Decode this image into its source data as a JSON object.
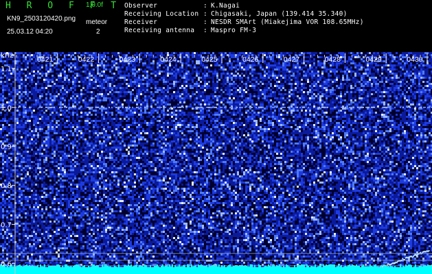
{
  "header": {
    "brand": "H R O F F T",
    "version": "1.0.0f",
    "filename": "KN9_2503120420.png",
    "datetime": "25.03.12 04:20",
    "control_label": "meteor",
    "control_value": "2"
  },
  "info": [
    {
      "label": "Observer",
      "value": "K.Nagai"
    },
    {
      "label": "Receiving Location",
      "value": "Chigasaki, Japan (139.414 35.340)"
    },
    {
      "label": "Receiver",
      "value": "NESDR SMArt (Miakejima VOR 108.65MHz)"
    },
    {
      "label": "Receiving antenna",
      "value": "Maspro FM-3"
    }
  ],
  "info_separator": ":",
  "chart_data": {
    "type": "heatmap",
    "ylabel": "kHz",
    "y_ticks": [
      "1.1",
      "1.0",
      "0.9",
      "0.8",
      "0.7",
      "0.6"
    ],
    "ylim": [
      0.58,
      1.14
    ],
    "x_ticks": [
      "0421",
      "0422",
      "0423",
      "0424",
      "0425",
      "0426",
      "0427",
      "0428",
      "0429",
      "0430"
    ],
    "colors": {
      "background": "#000033",
      "noise_low": "#1a2bd6",
      "noise_high": "#ffffff",
      "baseline": "#00ffff",
      "ref_line": "#a0b4c8"
    }
  }
}
